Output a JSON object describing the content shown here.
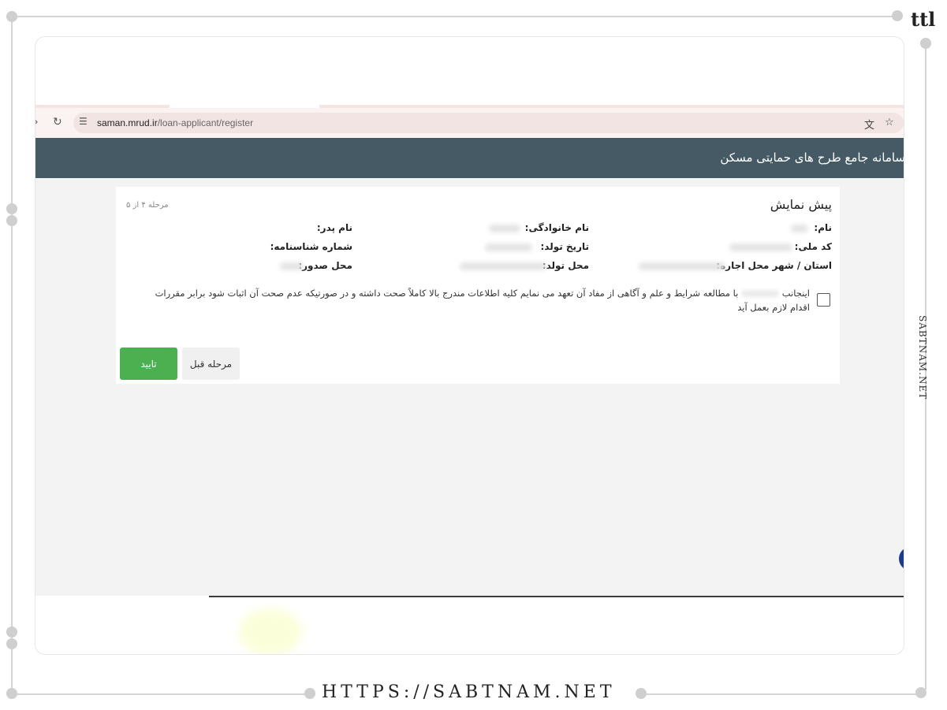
{
  "browser": {
    "url_domain": "saman.mrud.ir",
    "url_path": "/loan-applicant/register",
    "icons": {
      "back": "back-arrow-icon",
      "reload": "reload-icon",
      "site_info": "site-info-icon",
      "translate": "translate-icon",
      "bookmark": "star-icon"
    }
  },
  "site": {
    "title": "سامانه جامع طرح های حمایتی مسکن"
  },
  "preview": {
    "title": "پیش نمایش",
    "step": "مرحله ۴ از ۵",
    "fields": {
      "first_name": "نام:",
      "last_name": "نام خانوادگی:",
      "father_name": "نام پدر:",
      "national_code": "کد ملی:",
      "birth_date": "تاریخ تولد:",
      "id_number": "شماره شناسنامه:",
      "rental_location": "استان / شهر محل اجاره:",
      "birth_place": "محل تولد:",
      "issue_place": "محل صدور:"
    },
    "agreement_start": "اینجانب",
    "agreement_rest": "با مطالعه شرایط و علم و آگاهی از مفاد آن تعهد می نمایم کلیه اطلاعات مندرج بالا کاملاً صحت داشته و در صورتیکه عدم صحت آن اثبات شود برابر مقررات اقدام لازم بعمل آید",
    "confirm_label": "تایید",
    "prev_label": "مرحله قبل"
  },
  "watermark": {
    "side_text": "SABTNAM.NET",
    "bottom_url": "HTTPS://SABTNAM.NET",
    "logo": "ttl"
  },
  "colors": {
    "header": "#455a64",
    "confirm": "#4caf50"
  }
}
